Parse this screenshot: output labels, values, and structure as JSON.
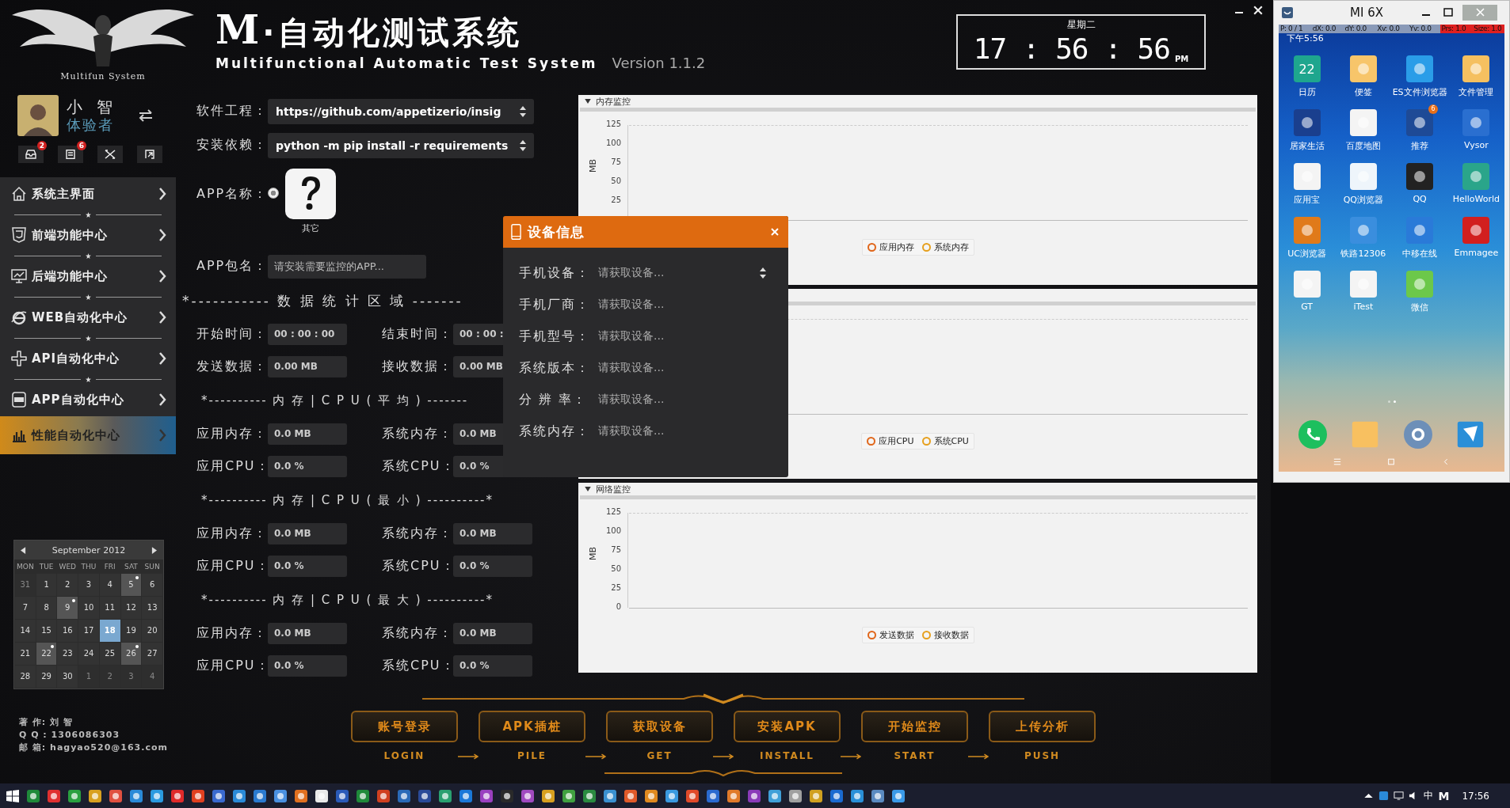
{
  "header": {
    "logo_caption": "Multifun System",
    "title_mark": "M",
    "title": "·自动化测试系统",
    "subtitle": "Multifunctional Automatic Test System",
    "version": "Version 1.1.2",
    "weekday": "星期二",
    "time": "17 : 56 : 56",
    "meridiem": "PM"
  },
  "user": {
    "name": "小 智",
    "role": "体验者"
  },
  "toolbar": [
    {
      "kind": "inbox",
      "badge": "2"
    },
    {
      "kind": "list",
      "badge": "6"
    },
    {
      "kind": "tools"
    },
    {
      "kind": "exit"
    }
  ],
  "nav": [
    {
      "label": "系统主界面",
      "kind": "home",
      "selected": false
    },
    {
      "label": "前端功能中心",
      "kind": "html",
      "selected": false
    },
    {
      "label": "后端功能中心",
      "kind": "monitor",
      "selected": false
    },
    {
      "label": "WEB自动化中心",
      "kind": "web",
      "selected": false
    },
    {
      "label": "API自动化中心",
      "kind": "api",
      "selected": false
    },
    {
      "label": "APP自动化中心",
      "kind": "app",
      "selected": false
    },
    {
      "label": "性能自动化中心",
      "kind": "chart",
      "selected": true
    }
  ],
  "calendar": {
    "month": "September 2012",
    "weekdays": [
      "MON",
      "TUE",
      "WED",
      "THU",
      "FRI",
      "SAT",
      "SUN"
    ],
    "days": [
      {
        "label": "31",
        "muted": true,
        "marked": false,
        "selected": false
      },
      {
        "label": "1",
        "muted": false,
        "marked": false,
        "selected": false
      },
      {
        "label": "2",
        "muted": false,
        "marked": false,
        "selected": false
      },
      {
        "label": "3",
        "muted": false,
        "marked": false,
        "selected": false
      },
      {
        "label": "4",
        "muted": false,
        "marked": false,
        "selected": false
      },
      {
        "label": "5",
        "muted": false,
        "marked": true,
        "selected": false
      },
      {
        "label": "6",
        "muted": false,
        "marked": false,
        "selected": false
      },
      {
        "label": "7",
        "muted": false,
        "marked": false,
        "selected": false
      },
      {
        "label": "8",
        "muted": false,
        "marked": false,
        "selected": false
      },
      {
        "label": "9",
        "muted": false,
        "marked": true,
        "selected": false
      },
      {
        "label": "10",
        "muted": false,
        "marked": false,
        "selected": false
      },
      {
        "label": "11",
        "muted": false,
        "marked": false,
        "selected": false
      },
      {
        "label": "12",
        "muted": false,
        "marked": false,
        "selected": false
      },
      {
        "label": "13",
        "muted": false,
        "marked": false,
        "selected": false
      },
      {
        "label": "14",
        "muted": false,
        "marked": false,
        "selected": false
      },
      {
        "label": "15",
        "muted": false,
        "marked": false,
        "selected": false
      },
      {
        "label": "16",
        "muted": false,
        "marked": false,
        "selected": false
      },
      {
        "label": "17",
        "muted": false,
        "marked": false,
        "selected": false
      },
      {
        "label": "18",
        "muted": false,
        "marked": false,
        "selected": true
      },
      {
        "label": "19",
        "muted": false,
        "marked": false,
        "selected": false
      },
      {
        "label": "20",
        "muted": false,
        "marked": false,
        "selected": false
      },
      {
        "label": "21",
        "muted": false,
        "marked": false,
        "selected": false
      },
      {
        "label": "22",
        "muted": false,
        "marked": true,
        "selected": false
      },
      {
        "label": "23",
        "muted": false,
        "marked": false,
        "selected": false
      },
      {
        "label": "24",
        "muted": false,
        "marked": false,
        "selected": false
      },
      {
        "label": "25",
        "muted": false,
        "marked": false,
        "selected": false
      },
      {
        "label": "26",
        "muted": false,
        "marked": true,
        "selected": false
      },
      {
        "label": "27",
        "muted": false,
        "marked": false,
        "selected": false
      },
      {
        "label": "28",
        "muted": false,
        "marked": false,
        "selected": false
      },
      {
        "label": "29",
        "muted": false,
        "marked": false,
        "selected": false
      },
      {
        "label": "30",
        "muted": false,
        "marked": false,
        "selected": false
      },
      {
        "label": "1",
        "muted": true,
        "marked": false,
        "selected": false
      },
      {
        "label": "2",
        "muted": true,
        "marked": false,
        "selected": false
      },
      {
        "label": "3",
        "muted": true,
        "marked": false,
        "selected": false
      },
      {
        "label": "4",
        "muted": true,
        "marked": false,
        "selected": false
      }
    ]
  },
  "author": [
    "著 作: 刘 智",
    "Q Q : 1306086303",
    "邮 箱: hagyao520@163.com"
  ],
  "form": {
    "selects": [
      {
        "label": "软件工程：",
        "value": "https://github.com/appetizerio/insig"
      },
      {
        "label": "安装依赖：",
        "value": "python -m pip install -r requirements"
      }
    ],
    "app_name": {
      "label": "APP名称：",
      "selected": true,
      "caption": "其它"
    },
    "package": {
      "label": "APP包名：",
      "placeholder": "请安装需要监控的APP..."
    }
  },
  "stats": [
    {
      "heading": "*----------- 数 据 统 计 区 域 -------",
      "rows": [
        [
          {
            "label": "开始时间：",
            "value": "00 : 00 : 00"
          },
          {
            "label": "结束时间：",
            "value": "00 : 00 :"
          }
        ],
        [
          {
            "label": "发送数据：",
            "value": "0.00 MB"
          },
          {
            "label": "接收数据：",
            "value": "0.00 MB"
          }
        ]
      ]
    },
    {
      "heading": "*---------- 内 存 | C P U ( 平 均 ) -------",
      "rows": [
        [
          {
            "label": "应用内存：",
            "value": "0.0 MB"
          },
          {
            "label": "系统内存：",
            "value": "0.0 MB"
          }
        ],
        [
          {
            "label": "应用CPU：",
            "value": "0.0 %"
          },
          {
            "label": "系统CPU：",
            "value": "0.0 %"
          }
        ]
      ]
    },
    {
      "heading": "*---------- 内 存 | C P U ( 最 小 ) ----------*",
      "rows": [
        [
          {
            "label": "应用内存：",
            "value": "0.0 MB"
          },
          {
            "label": "系统内存：",
            "value": "0.0 MB"
          }
        ],
        [
          {
            "label": "应用CPU：",
            "value": "0.0 %"
          },
          {
            "label": "系统CPU：",
            "value": "0.0 %"
          }
        ]
      ]
    },
    {
      "heading": "*---------- 内 存 | C P U ( 最 大 ) ----------*",
      "rows": [
        [
          {
            "label": "应用内存：",
            "value": "0.0 MB"
          },
          {
            "label": "系统内存：",
            "value": "0.0 MB"
          }
        ],
        [
          {
            "label": "应用CPU：",
            "value": "0.0 %"
          },
          {
            "label": "系统CPU：",
            "value": "0.0 %"
          }
        ]
      ]
    }
  ],
  "monitors": [
    {
      "title": "内存监控",
      "y_label": "MB",
      "y_ticks": [
        "125",
        "100",
        "75",
        "50",
        "25"
      ],
      "legend": [
        {
          "label": "应用内存",
          "color": "#e0661a"
        },
        {
          "label": "系统内存",
          "color": "#e6a01e"
        }
      ]
    },
    {
      "legend": [
        {
          "label": "应用CPU",
          "color": "#e0661a"
        },
        {
          "label": "系统CPU",
          "color": "#e6a01e"
        }
      ]
    },
    {
      "title": "网络监控",
      "y_label": "MB",
      "y_ticks": [
        "125",
        "100",
        "75",
        "50",
        "25",
        "0"
      ],
      "legend": [
        {
          "label": "发送数据",
          "color": "#e0661a"
        },
        {
          "label": "接收数据",
          "color": "#e6a01e"
        }
      ]
    }
  ],
  "device_dialog": {
    "title": "设备信息",
    "rows": [
      {
        "label": "手机设备：",
        "value": "请获取设备...",
        "kind": "select"
      },
      {
        "label": "手机厂商：",
        "value": "请获取设备...",
        "kind": "text"
      },
      {
        "label": "手机型号：",
        "value": "请获取设备...",
        "kind": "text"
      },
      {
        "label": "系统版本：",
        "value": "请获取设备...",
        "kind": "text"
      },
      {
        "label": "分 辨 率：",
        "value": "请获取设备...",
        "kind": "text"
      },
      {
        "label": "系统内存：",
        "value": "请获取设备...",
        "kind": "text"
      }
    ]
  },
  "steps": [
    {
      "label": "账号登录",
      "caption": "LOGIN"
    },
    {
      "label": "APK插桩",
      "caption": "PILE"
    },
    {
      "label": "获取设备",
      "caption": "GET"
    },
    {
      "label": "安装APK",
      "caption": "INSTALL"
    },
    {
      "label": "开始监控",
      "caption": "START"
    },
    {
      "label": "上传分析",
      "caption": "PUSH"
    }
  ],
  "phone": {
    "title": "MI 6X",
    "overlay": [
      {
        "text": "P: 0 / 1",
        "alert": false
      },
      {
        "text": "dX: 0.0",
        "alert": false
      },
      {
        "text": "dY: 0.0",
        "alert": false
      },
      {
        "text": "Xv: 0.0",
        "alert": false
      },
      {
        "text": "Yv: 0.0",
        "alert": false
      },
      {
        "text": "Prs: 1.0",
        "alert": true
      },
      {
        "text": "Size: 1.0",
        "alert": true
      }
    ],
    "status_time": "下午5:56",
    "apps": [
      {
        "label": "日历",
        "color": "#1ea68e",
        "text": "22"
      },
      {
        "label": "便签",
        "color": "#f7c56a"
      },
      {
        "label": "ES文件浏览器",
        "color": "#2a9de8"
      },
      {
        "label": "文件管理",
        "color": "#f5c060"
      },
      {
        "label": "居家生活",
        "color": "#1a3f8e"
      },
      {
        "label": "百度地图",
        "color": "#f4f4f4"
      },
      {
        "label": "推荐",
        "color": "#1e4a96",
        "badge": "6"
      },
      {
        "label": "Vysor",
        "color": "#2a6fd0"
      },
      {
        "label": "应用宝",
        "color": "#f4f4f4"
      },
      {
        "label": "QQ浏览器",
        "color": "#eef5fb"
      },
      {
        "label": "QQ",
        "color": "#222222"
      },
      {
        "label": "HelloWorld",
        "color": "#2aa58a"
      },
      {
        "label": "UC浏览器",
        "color": "#e07a1a"
      },
      {
        "label": "铁路12306",
        "color": "#3a8ede"
      },
      {
        "label": "中移在线",
        "color": "#2a7ad8"
      },
      {
        "label": "Emmagee",
        "color": "#d21f1f"
      },
      {
        "label": "GT",
        "color": "#f4f4f4"
      },
      {
        "label": "iTest",
        "color": "#f4f4f4"
      },
      {
        "label": "微信",
        "color": "#6cc84a"
      }
    ],
    "dock": [
      {
        "kind": "phone",
        "color": "#1dbf5e"
      },
      {
        "kind": "notes",
        "color": "#f8c060"
      },
      {
        "kind": "settings",
        "color": "#6d8fb8"
      },
      {
        "kind": "app",
        "color": "#2a8fd8"
      }
    ],
    "pages": [
      {
        "selected": false
      },
      {
        "selected": true
      }
    ]
  },
  "taskbar": {
    "input_method": "中",
    "tray_letter": "M",
    "clock": "17:56"
  }
}
